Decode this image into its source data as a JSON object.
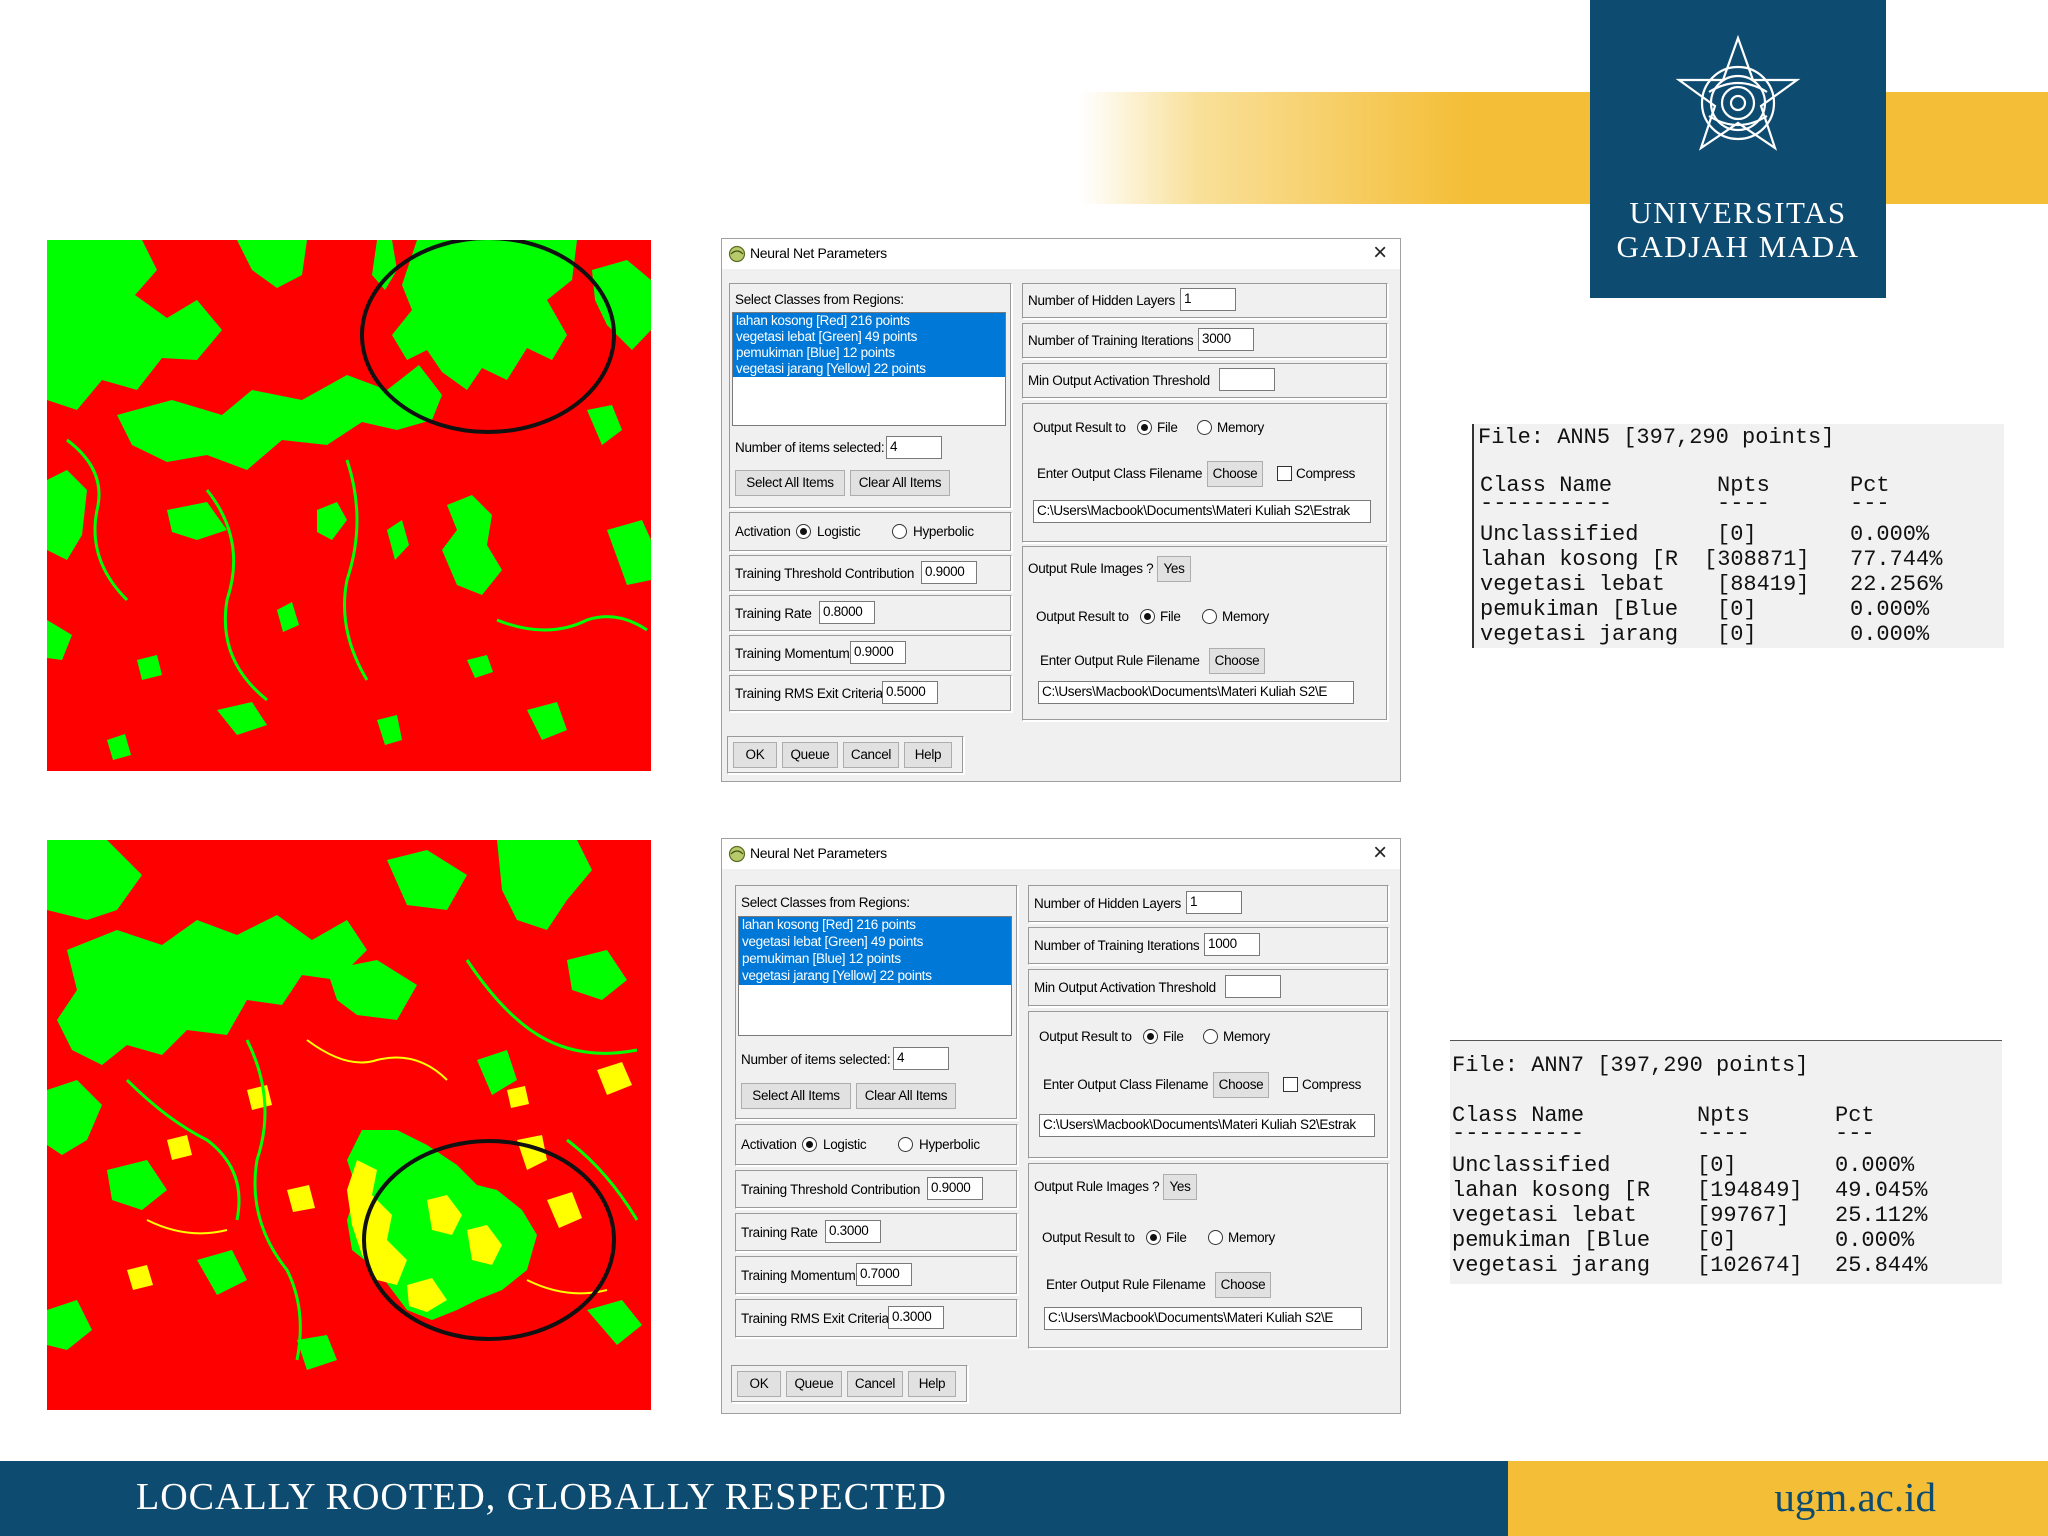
{
  "header": {
    "logo_line1": "UNIVERSITAS",
    "logo_line2": "GADJAH MADA"
  },
  "footer": {
    "tagline": "LOCALLY ROOTED, GLOBALLY RESPECTED",
    "site": "ugm.ac.id"
  },
  "colors": {
    "brand_blue": "#0e4b71",
    "brand_yellow": "#f4be37",
    "class_red": "#ff0000",
    "class_green": "#00ff00",
    "class_yellow": "#ffff00",
    "selection_blue": "#0078d7"
  },
  "maps": [
    {
      "name": "ANN5 classification map",
      "classes_shown": [
        "Red",
        "Green"
      ],
      "highlight": "black ellipse"
    },
    {
      "name": "ANN7 classification map",
      "classes_shown": [
        "Red",
        "Green",
        "Yellow"
      ],
      "highlight": "black ellipse"
    }
  ],
  "dialog1": {
    "title": "Neural Net Parameters",
    "select_classes_label": "Select Classes from Regions:",
    "classes": [
      "lahan kosong [Red] 216 points",
      "vegetasi lebat [Green] 49 points",
      "pemukiman [Blue] 12 points",
      "vegetasi jarang [Yellow] 22 points"
    ],
    "items_selected_label": "Number of items selected:",
    "items_selected": "4",
    "select_all": "Select All Items",
    "clear_all": "Clear All Items",
    "activation_label": "Activation",
    "logistic": "Logistic",
    "hyperbolic": "Hyperbolic",
    "threshold_label": "Training Threshold Contribution",
    "threshold": "0.9000",
    "rate_label": "Training Rate",
    "rate": "0.8000",
    "momentum_label": "Training Momentum",
    "momentum": "0.9000",
    "rms_label": "Training RMS Exit Criteria",
    "rms": "0.5000",
    "hidden_label": "Number of Hidden Layers",
    "hidden": "1",
    "iterations_label": "Number of Training Iterations",
    "iterations": "3000",
    "min_act_label": "Min Output Activation Threshold",
    "min_act": "",
    "output_to_label": "Output Result to",
    "file": "File",
    "memory": "Memory",
    "class_filename_label": "Enter Output Class Filename",
    "choose": "Choose",
    "compress": "Compress",
    "class_path": "C:\\Users\\Macbook\\Documents\\Materi Kuliah S2\\Estrak",
    "rule_images_label": "Output Rule Images ?",
    "rule_images": "Yes",
    "rule_filename_label": "Enter Output Rule Filename",
    "rule_path": "C:\\Users\\Macbook\\Documents\\Materi Kuliah S2\\E",
    "ok": "OK",
    "queue": "Queue",
    "cancel": "Cancel",
    "help": "Help"
  },
  "dialog2": {
    "title": "Neural Net Parameters",
    "select_classes_label": "Select Classes from Regions:",
    "classes": [
      "lahan kosong [Red] 216 points",
      "vegetasi lebat [Green] 49 points",
      "pemukiman [Blue] 12 points",
      "vegetasi jarang [Yellow] 22 points"
    ],
    "items_selected_label": "Number of items selected:",
    "items_selected": "4",
    "select_all": "Select All Items",
    "clear_all": "Clear All Items",
    "activation_label": "Activation",
    "logistic": "Logistic",
    "hyperbolic": "Hyperbolic",
    "threshold_label": "Training Threshold Contribution",
    "threshold": "0.9000",
    "rate_label": "Training Rate",
    "rate": "0.3000",
    "momentum_label": "Training Momentum",
    "momentum": "0.7000",
    "rms_label": "Training RMS Exit Criteria",
    "rms": "0.3000",
    "hidden_label": "Number of Hidden Layers",
    "hidden": "1",
    "iterations_label": "Number of Training Iterations",
    "iterations": "1000",
    "min_act_label": "Min Output Activation Threshold",
    "min_act": "",
    "output_to_label": "Output Result to",
    "file": "File",
    "memory": "Memory",
    "class_filename_label": "Enter Output Class Filename",
    "choose": "Choose",
    "compress": "Compress",
    "class_path": "C:\\Users\\Macbook\\Documents\\Materi Kuliah S2\\Estrak",
    "rule_images_label": "Output Rule Images ?",
    "rule_images": "Yes",
    "rule_filename_label": "Enter Output Rule Filename",
    "rule_path": "C:\\Users\\Macbook\\Documents\\Materi Kuliah S2\\E",
    "ok": "OK",
    "queue": "Queue",
    "cancel": "Cancel",
    "help": "Help"
  },
  "stats1": {
    "file_line": "File: ANN5 [397,290 points]",
    "headers": [
      "Class Name",
      "Npts",
      "Pct"
    ],
    "dashes": [
      "----------",
      "----",
      "---"
    ],
    "rows": [
      {
        "name": "Unclassified",
        "npts": "[0]",
        "pct": "0.000%"
      },
      {
        "name": "lahan kosong [R",
        "npts": "[308871]",
        "pct": "77.744%"
      },
      {
        "name": "vegetasi lebat",
        "npts": "[88419]",
        "pct": "22.256%"
      },
      {
        "name": "pemukiman [Blue",
        "npts": "[0]",
        "pct": "0.000%"
      },
      {
        "name": "vegetasi jarang",
        "npts": "[0]",
        "pct": "0.000%"
      }
    ]
  },
  "stats2": {
    "file_line": "File: ANN7 [397,290 points]",
    "headers": [
      "Class Name",
      "Npts",
      "Pct"
    ],
    "dashes": [
      "----------",
      "----",
      "---"
    ],
    "rows": [
      {
        "name": "Unclassified",
        "npts": "[0]",
        "pct": "0.000%"
      },
      {
        "name": "lahan kosong [R",
        "npts": "[194849]",
        "pct": "49.045%"
      },
      {
        "name": "vegetasi lebat",
        "npts": "[99767]",
        "pct": "25.112%"
      },
      {
        "name": "pemukiman [Blue",
        "npts": "[0]",
        "pct": "0.000%"
      },
      {
        "name": "vegetasi jarang",
        "npts": "[102674]",
        "pct": "25.844%"
      }
    ]
  }
}
